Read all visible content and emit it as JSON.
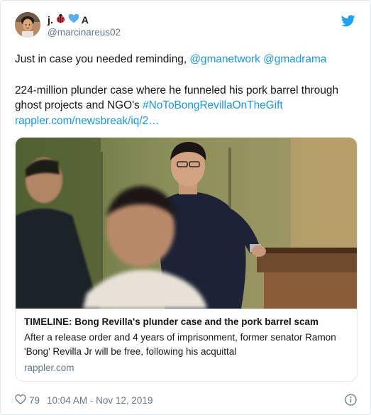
{
  "author": {
    "display_name": "j.",
    "name_emoji_icons": [
      "ladybug-icon",
      "blue-heart-icon"
    ],
    "name_suffix": "A",
    "handle": "@marcinareus02"
  },
  "tweet": {
    "line1_text": "Just in case you needed reminding, ",
    "mention1": "@gmanetwork",
    "mention2": "@gmadrama",
    "line2_text": "224-million plunder case where he funneled his pork barrel through ghost projects and NGO's ",
    "hashtag": "#NoToBongRevillaOnTheGift",
    "url": "rappler.com/newsbreak/iq/2…"
  },
  "card": {
    "title": "TIMELINE: Bong Revilla's plunder case and the pork barrel scam",
    "description": "After a release order and 4 years of imprisonment, former senator Ramon 'Bong' Revilla Jr will be free, following his acquittal",
    "domain": "rappler.com"
  },
  "footer": {
    "like_count": "79",
    "timestamp": "10:04 AM - Nov 12, 2019"
  },
  "colors": {
    "link": "#1b95e0",
    "twitter_blue": "#1da1f2",
    "secondary_text": "#657786",
    "border": "#e1e8ed"
  }
}
